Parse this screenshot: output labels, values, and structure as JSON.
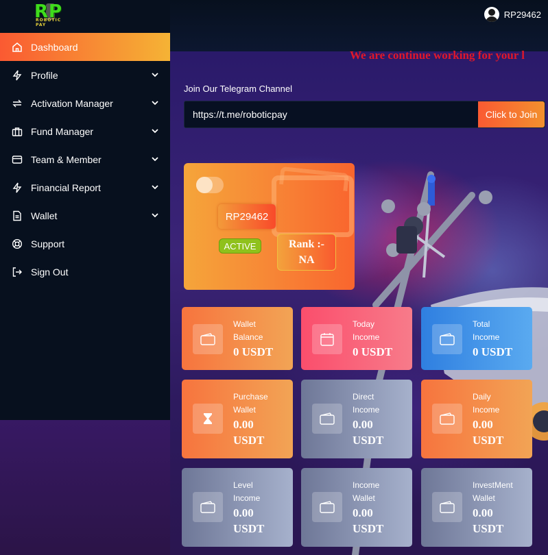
{
  "topbar": {
    "logo_text": "RP",
    "logo_sub": "ROBOTIC PAY",
    "username": "RP29462"
  },
  "sidebar": {
    "items": [
      {
        "label": "Dashboard",
        "icon": "home-icon",
        "active": true
      },
      {
        "label": "Profile",
        "icon": "bolt-icon"
      },
      {
        "label": "Activation Manager",
        "icon": "exchange-icon"
      },
      {
        "label": "Fund Manager",
        "icon": "briefcase-icon"
      },
      {
        "label": "Team & Member",
        "icon": "card-icon"
      },
      {
        "label": "Financial Report",
        "icon": "bolt-icon"
      },
      {
        "label": "Wallet",
        "icon": "document-icon"
      },
      {
        "label": "Support",
        "icon": "lifebuoy-icon"
      },
      {
        "label": "Sign Out",
        "icon": "sign-out-icon"
      }
    ]
  },
  "marquee": "We are continue working for your l",
  "telegram": {
    "label": "Join Our Telegram Channel",
    "link_value": "https://t.me/roboticpay",
    "button": "Click to Join"
  },
  "profile_card": {
    "user_id": "RP29462",
    "status": "ACTIVE",
    "rank": "Rank :- NA"
  },
  "cards": [
    {
      "label1": "Wallet",
      "label2": "Balance",
      "value": "0 USDT",
      "icon": "wallet-icon",
      "color": "#f7743e"
    },
    {
      "label1": "Today",
      "label2": "Income",
      "value": "0 USDT",
      "icon": "calendar-icon",
      "color": "#fb4e6c"
    },
    {
      "label1": "Total",
      "label2": "Income",
      "value": "0 USDT",
      "icon": "wallet-icon",
      "color": "#2f7fe0"
    },
    {
      "label1": "Purchase",
      "label2": "Wallet",
      "value1": "0.00",
      "value2": "USDT",
      "icon": "hourglass-icon",
      "color": "#f7743e"
    },
    {
      "label1": "Direct",
      "label2": "Income",
      "value1": "0.00",
      "value2": "USDT",
      "icon": "wallet-icon",
      "color": "#6e7797"
    },
    {
      "label1": "Daily",
      "label2": "Income",
      "value1": "0.00",
      "value2": "USDT",
      "icon": "wallet-icon",
      "color": "#f7743e"
    },
    {
      "label1": "Level",
      "label2": "Income",
      "value1": "0.00",
      "value2": "USDT",
      "icon": "wallet-icon",
      "color": "#6e7797"
    },
    {
      "label1": "Income",
      "label2": "Wallet",
      "value1": "0.00",
      "value2": "USDT",
      "icon": "wallet-icon",
      "color": "#6e7797"
    },
    {
      "label1": "InvestMent",
      "label2": "Wallet",
      "value1": "0.00",
      "value2": "USDT",
      "icon": "wallet-icon",
      "color": "#6e7797"
    }
  ]
}
